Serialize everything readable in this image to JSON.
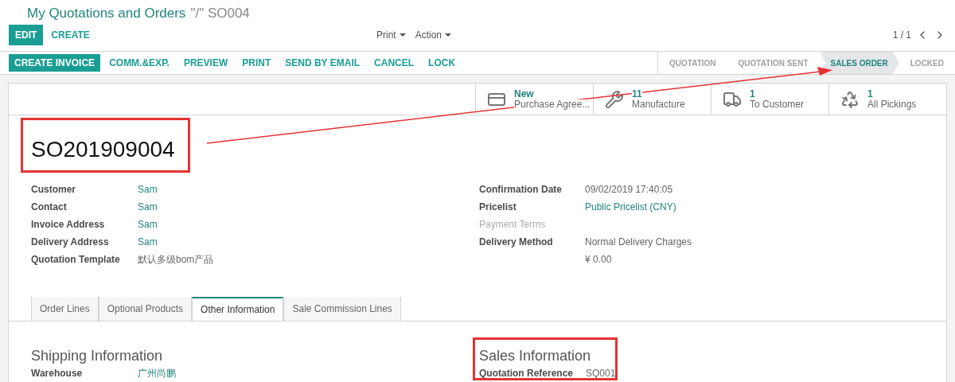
{
  "breadcrumb": {
    "title": "My Quotations and Orders",
    "record": "\"/\" SO004"
  },
  "main_buttons": [
    {
      "label": "EDIT",
      "primary": true
    },
    {
      "label": "CREATE",
      "primary": false
    }
  ],
  "dropdowns": [
    "Print",
    "Action"
  ],
  "pager": "1 / 1",
  "action_buttons": [
    {
      "label": "CREATE INVOICE",
      "primary": true
    },
    {
      "label": "COMM.&EXP.",
      "primary": false
    },
    {
      "label": "PREVIEW",
      "primary": false
    },
    {
      "label": "PRINT",
      "primary": false
    },
    {
      "label": "SEND BY EMAIL",
      "primary": false
    },
    {
      "label": "CANCEL",
      "primary": false
    },
    {
      "label": "LOCK",
      "primary": false
    }
  ],
  "status_steps": [
    {
      "label": "QUOTATION",
      "selected": false
    },
    {
      "label": "QUOTATION SENT",
      "selected": false
    },
    {
      "label": "SALES ORDER",
      "selected": true
    },
    {
      "label": "LOCKED",
      "selected": false
    }
  ],
  "smart_buttons": [
    {
      "kind": "card",
      "count": "New",
      "label": "Purchase Agree..."
    },
    {
      "kind": "wrench",
      "count": "11",
      "label": "Manufacture"
    },
    {
      "kind": "truck",
      "count": "1",
      "label": "To Customer"
    },
    {
      "kind": "recycle",
      "count": "1",
      "label": "All Pickings"
    }
  ],
  "record_name": "SO201909004",
  "left_fields": [
    {
      "label": "Customer",
      "value": "Sam",
      "kind": "link",
      "disabled": false
    },
    {
      "label": "Contact",
      "value": "Sam",
      "kind": "link",
      "disabled": false
    },
    {
      "label": "Invoice Address",
      "value": "Sam",
      "kind": "link",
      "disabled": false
    },
    {
      "label": "Delivery Address",
      "value": "Sam",
      "kind": "link",
      "disabled": false
    },
    {
      "label": "Quotation Template",
      "value": "默认多级bom产品",
      "kind": "text",
      "disabled": false
    }
  ],
  "right_fields": [
    {
      "label": "Confirmation Date",
      "value": "09/02/2019 17:40:05",
      "kind": "text",
      "disabled": false
    },
    {
      "label": "Pricelist",
      "value": "Public Pricelist (CNY)",
      "kind": "link",
      "disabled": false
    },
    {
      "label": "Payment Terms",
      "disabled": true
    },
    {
      "label": "Delivery Method",
      "value": "Normal Delivery Charges",
      "kind": "text",
      "disabled": false
    },
    {
      "value": "¥ 0.00",
      "kind": "text",
      "disabled": false
    }
  ],
  "tabs": [
    {
      "label": "Order Lines",
      "selected": false
    },
    {
      "label": "Optional Products",
      "selected": false
    },
    {
      "label": "Other Information",
      "selected": true
    },
    {
      "label": "Sale Commission Lines",
      "selected": false
    }
  ],
  "shipping": {
    "heading": "Shipping Information",
    "fields": [
      {
        "label": "Warehouse",
        "value": "广州尚鹏",
        "kind": "link",
        "disabled": false
      }
    ]
  },
  "sales": {
    "heading": "Sales Information",
    "fields": [
      {
        "label": "Quotation Reference",
        "value": "SQ001",
        "kind": "text",
        "disabled": false
      }
    ]
  }
}
